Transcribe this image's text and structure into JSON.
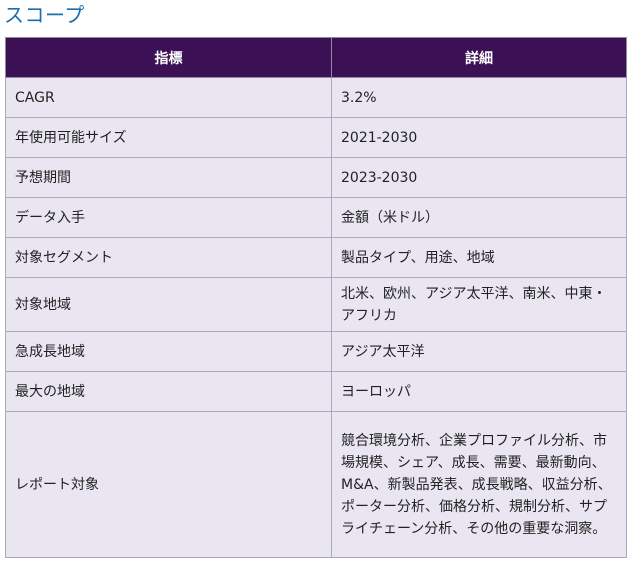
{
  "title": "スコープ",
  "table": {
    "headers": [
      "指標",
      "詳細"
    ],
    "rows": [
      {
        "metric": "CAGR",
        "detail": "3.2%"
      },
      {
        "metric": "年使用可能サイズ",
        "detail": "2021-2030"
      },
      {
        "metric": "予想期間",
        "detail": "2023-2030"
      },
      {
        "metric": "データ入手",
        "detail": "金額（米ドル）"
      },
      {
        "metric": "対象セグメント",
        "detail": "製品タイプ、用途、地域"
      },
      {
        "metric": "対象地域",
        "detail": "北米、欧州、アジア太平洋、南米、中東・アフリカ"
      },
      {
        "metric": "急成長地域",
        "detail": "アジア太平洋"
      },
      {
        "metric": "最大の地域",
        "detail": "ヨーロッパ"
      },
      {
        "metric": "レポート対象",
        "detail": "競合環境分析、企業プロファイル分析、市場規模、シェア、成長、需要、最新動向、M&A、新製品発表、成長戦略、収益分析、ポーター分析、価格分析、規制分析、サプライチェーン分析、その他の重要な洞察。"
      }
    ]
  },
  "colors": {
    "title": "#1a6fb0",
    "header_bg": "#3b1054",
    "header_text": "#ffffff",
    "row_bg": "#e9e6f1",
    "border": "#a9a9b7"
  }
}
